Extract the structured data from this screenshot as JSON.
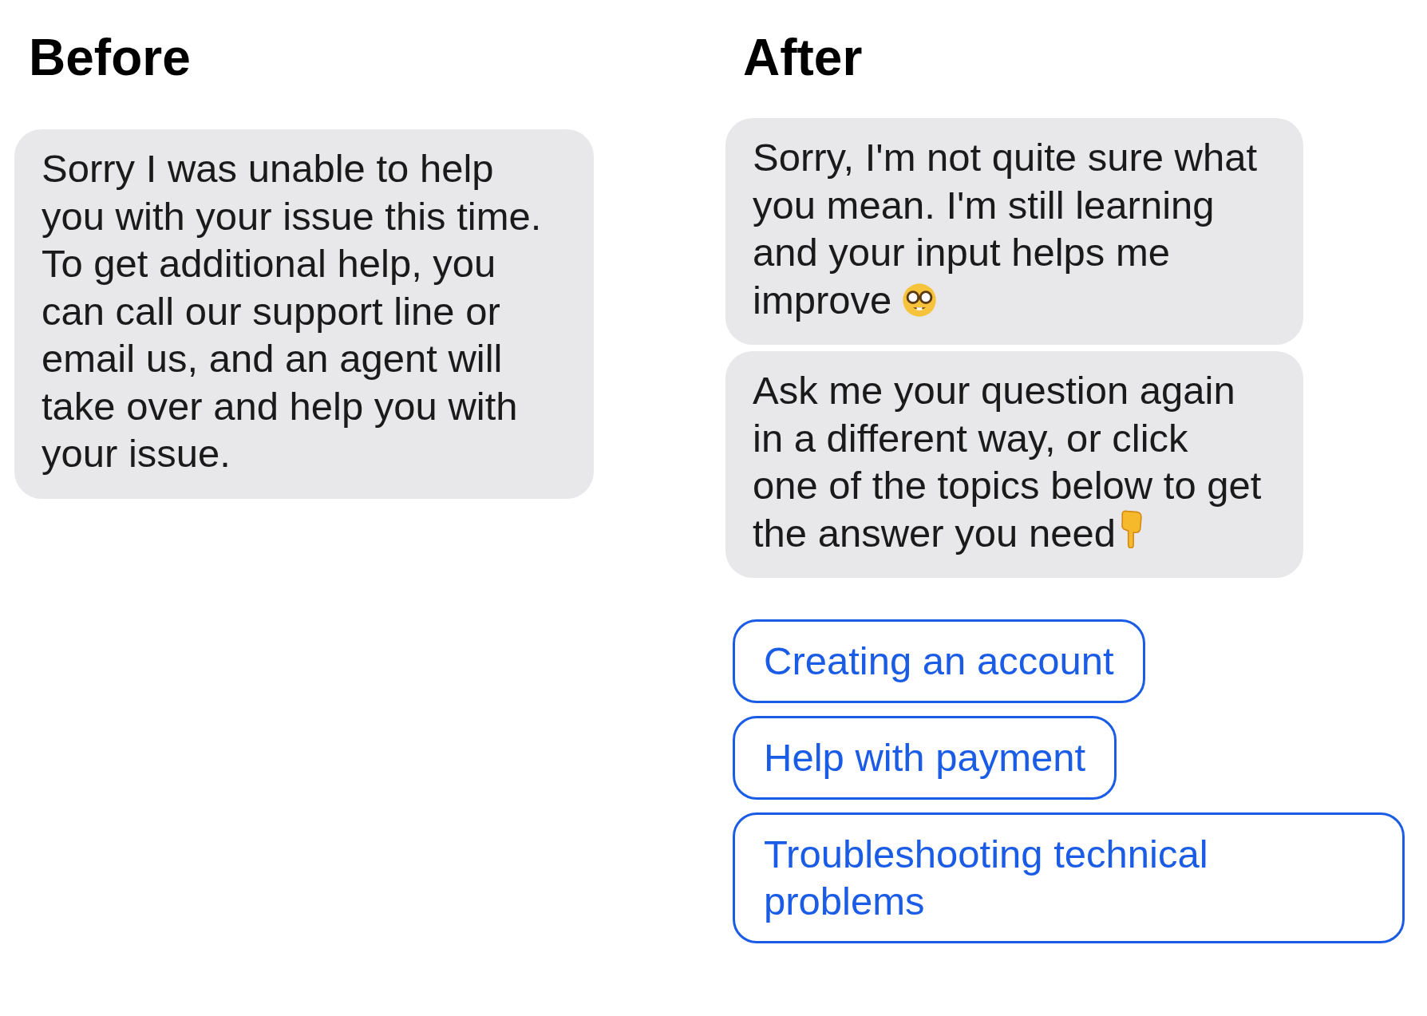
{
  "before": {
    "heading": "Before",
    "messages": [
      {
        "text": "Sorry I was unable to help you with your issue this time. To get additional help, you can call our support line or email us, and an agent will take over and help you with your issue."
      }
    ]
  },
  "after": {
    "heading": "After",
    "messages": [
      {
        "text": "Sorry, I'm not quite sure what you mean. I'm still learning and your input helps me improve",
        "kind": "nerd"
      },
      {
        "text": "Ask me your question again in a different way, or click one of the topics below to get the answer you need",
        "kind": "point-down"
      }
    ],
    "topics": [
      "Creating an account",
      "Help with payment",
      "Troubleshooting technical problems"
    ]
  }
}
